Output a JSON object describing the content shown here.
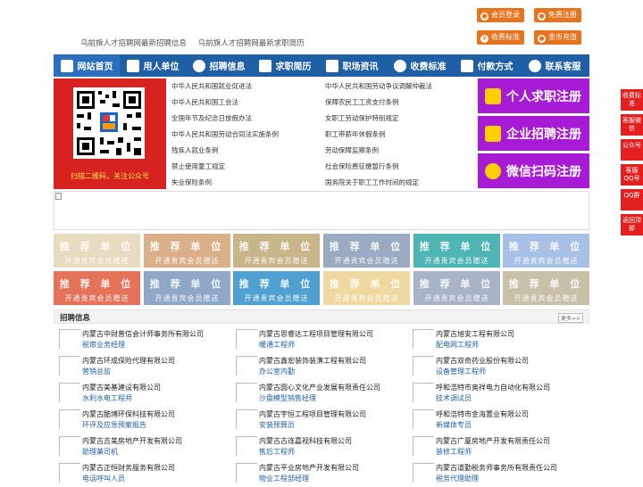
{
  "top_links": [
    "乌前旗人才招聘网最新招聘信息",
    "乌前旗人才招聘网最新求职简历"
  ],
  "top_buttons": {
    "member_login": "会员登录",
    "free_register": "免费注册",
    "fee_standard": "收费标准",
    "coin_recharge": "金币充值"
  },
  "nav": [
    "网站首页",
    "用人单位",
    "招聘信息",
    "求职简历",
    "职场资讯",
    "收费标准",
    "付款方式",
    "联系客服"
  ],
  "qr_caption": "扫描二维码，关注公众号",
  "laws_left": [
    "中华人民共和国就业促进法",
    "中华人民共和国工会法",
    "全国年节及纪念日放假办法",
    "中华人民共和国劳动合同法实施条例",
    "残疾人就业条例",
    "禁止使用童工规定",
    "失业保险条例"
  ],
  "laws_right": [
    "中华人民共和国劳动争议调解仲裁法",
    "保障农民工工资支付条例",
    "女职工劳动保护特别规定",
    "职工带薪年休假条例",
    "劳动保障监察条例",
    "社会保险费征缴暂行条例",
    "国务院关于职工工作时间的规定"
  ],
  "register": [
    "个人求职注册",
    "企业招聘注册",
    "微信扫码注册"
  ],
  "recommend": {
    "title": "推 荐 单 位",
    "sub": "开通贵宾会员赠送"
  },
  "recommend_colors": [
    "#e8dcc0",
    "#d9b08a",
    "#c9b58a",
    "#9aaac0",
    "#4fb4b4",
    "#a9c0e6",
    "#e4735a",
    "#8fa8c8",
    "#4f9fd0",
    "#f0d9a0",
    "#a9b3c8",
    "#c8c0a8"
  ],
  "jobs": {
    "title": "招聘信息",
    "more": "更多>>",
    "items": [
      {
        "company": "内蒙古中财普信会计师事务所有限公司",
        "job": "税审业务经理"
      },
      {
        "company": "内蒙古思睿达工程项目管理有限公司",
        "job": "暖通工程师"
      },
      {
        "company": "内蒙古旭安工程有限公司",
        "job": "配电网工程师"
      },
      {
        "company": "内蒙古环成保险代理有限公司",
        "job": "营销总监"
      },
      {
        "company": "内蒙古鑫宏装饰装潢工程有限公司",
        "job": "办公室内勤"
      },
      {
        "company": "内蒙古双奇药业股份有限公司",
        "job": "设备管理工程师"
      },
      {
        "company": "内蒙古美基建设有限公司",
        "job": "水利水电工程师"
      },
      {
        "company": "内蒙古圆心文化产业发展有限责任公司",
        "job": "沙盘模型销售经理"
      },
      {
        "company": "呼和浩特市奥祥电力自动化有限公司",
        "job": "技术调试员"
      },
      {
        "company": "内蒙古酷博环保科技有限公司",
        "job": "环评及应急预案报告"
      },
      {
        "company": "内蒙古宇恒工程项目管理有限公司",
        "job": "安装预算员"
      },
      {
        "company": "呼和浩特市金海置业有限公司",
        "job": "新媒体专员"
      },
      {
        "company": "内蒙古吉美房地产开发有限公司",
        "job": "助理兼司机"
      },
      {
        "company": "内蒙古古连嘉视科技有限公司",
        "job": "售后工程师"
      },
      {
        "company": "内蒙古广厦房地产开发有限责任公司",
        "job": "装修工程师"
      },
      {
        "company": "内蒙古正恒财务服务有限公司",
        "job": "电话呼叫人员"
      },
      {
        "company": "内蒙古平业房地产开发有限公司",
        "job": "物业工程部经理"
      },
      {
        "company": "内蒙古道勤税务师事务所有限责任公司",
        "job": "税务代理助理"
      }
    ]
  },
  "side_buttons": [
    "收费标准",
    "客服微信",
    "公众号",
    "客服QQ号",
    "QQ群",
    "返回顶部"
  ]
}
